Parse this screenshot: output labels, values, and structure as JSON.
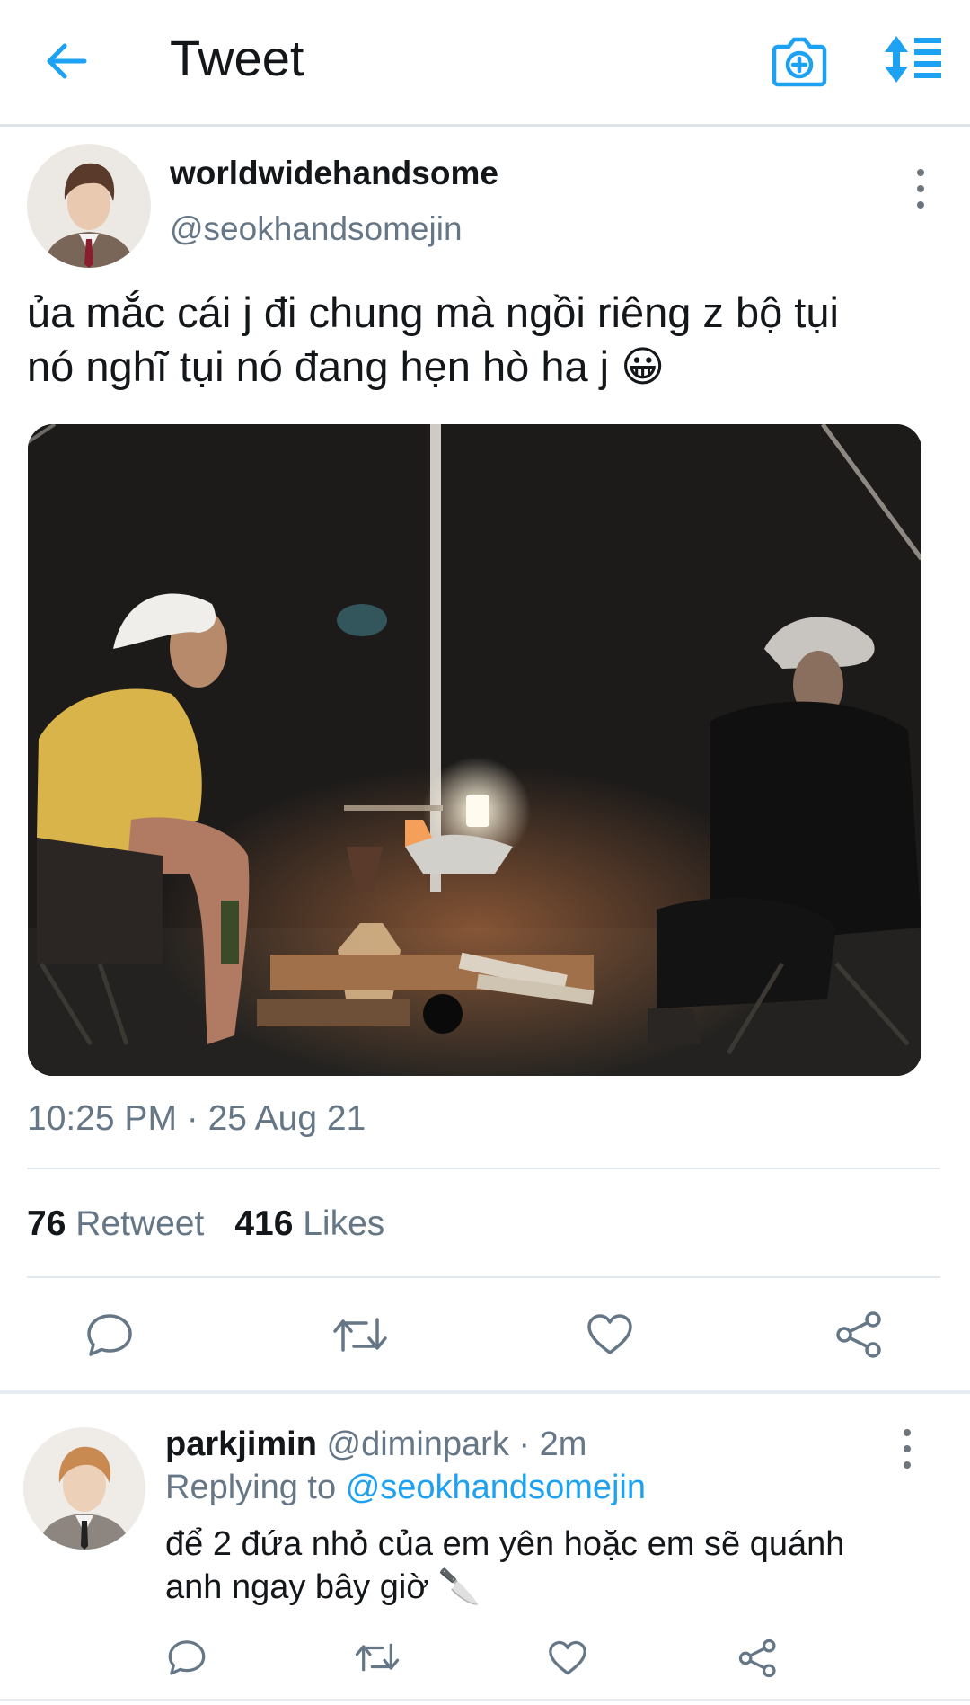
{
  "topbar": {
    "title": "Tweet",
    "back_icon": "arrow-left-icon",
    "camera_icon": "camera-plus-icon",
    "sort_icon": "sort-list-icon"
  },
  "tweet": {
    "display_name": "worldwidehandsome",
    "handle": "@seokhandsomejin",
    "text_line1": "ủa mắc cái j đi chung mà ngồi riêng z bộ tụi",
    "text_line2": "nó nghĩ tụi nó đang hẹn hò ha j",
    "emoji": "😀",
    "timestamp": "10:25 PM · 25 Aug 21",
    "retweet_count": "76",
    "retweet_label": "Retweet",
    "like_count": "416",
    "like_label": "Likes"
  },
  "reply": {
    "display_name": "parkjimin",
    "meta": "@diminpark · 2m",
    "replying_label": "Replying to",
    "replying_handle": "@seokhandsomejin",
    "text_line1": "để 2 đứa nhỏ của em yên hoặc em sẽ quánh",
    "text_line2": "anh ngay bây giờ",
    "emoji": "🔪"
  },
  "colors": {
    "accent": "#1da1f2",
    "secondary_text": "#657786",
    "primary_text": "#14171a",
    "divider": "#e1e8ed"
  }
}
